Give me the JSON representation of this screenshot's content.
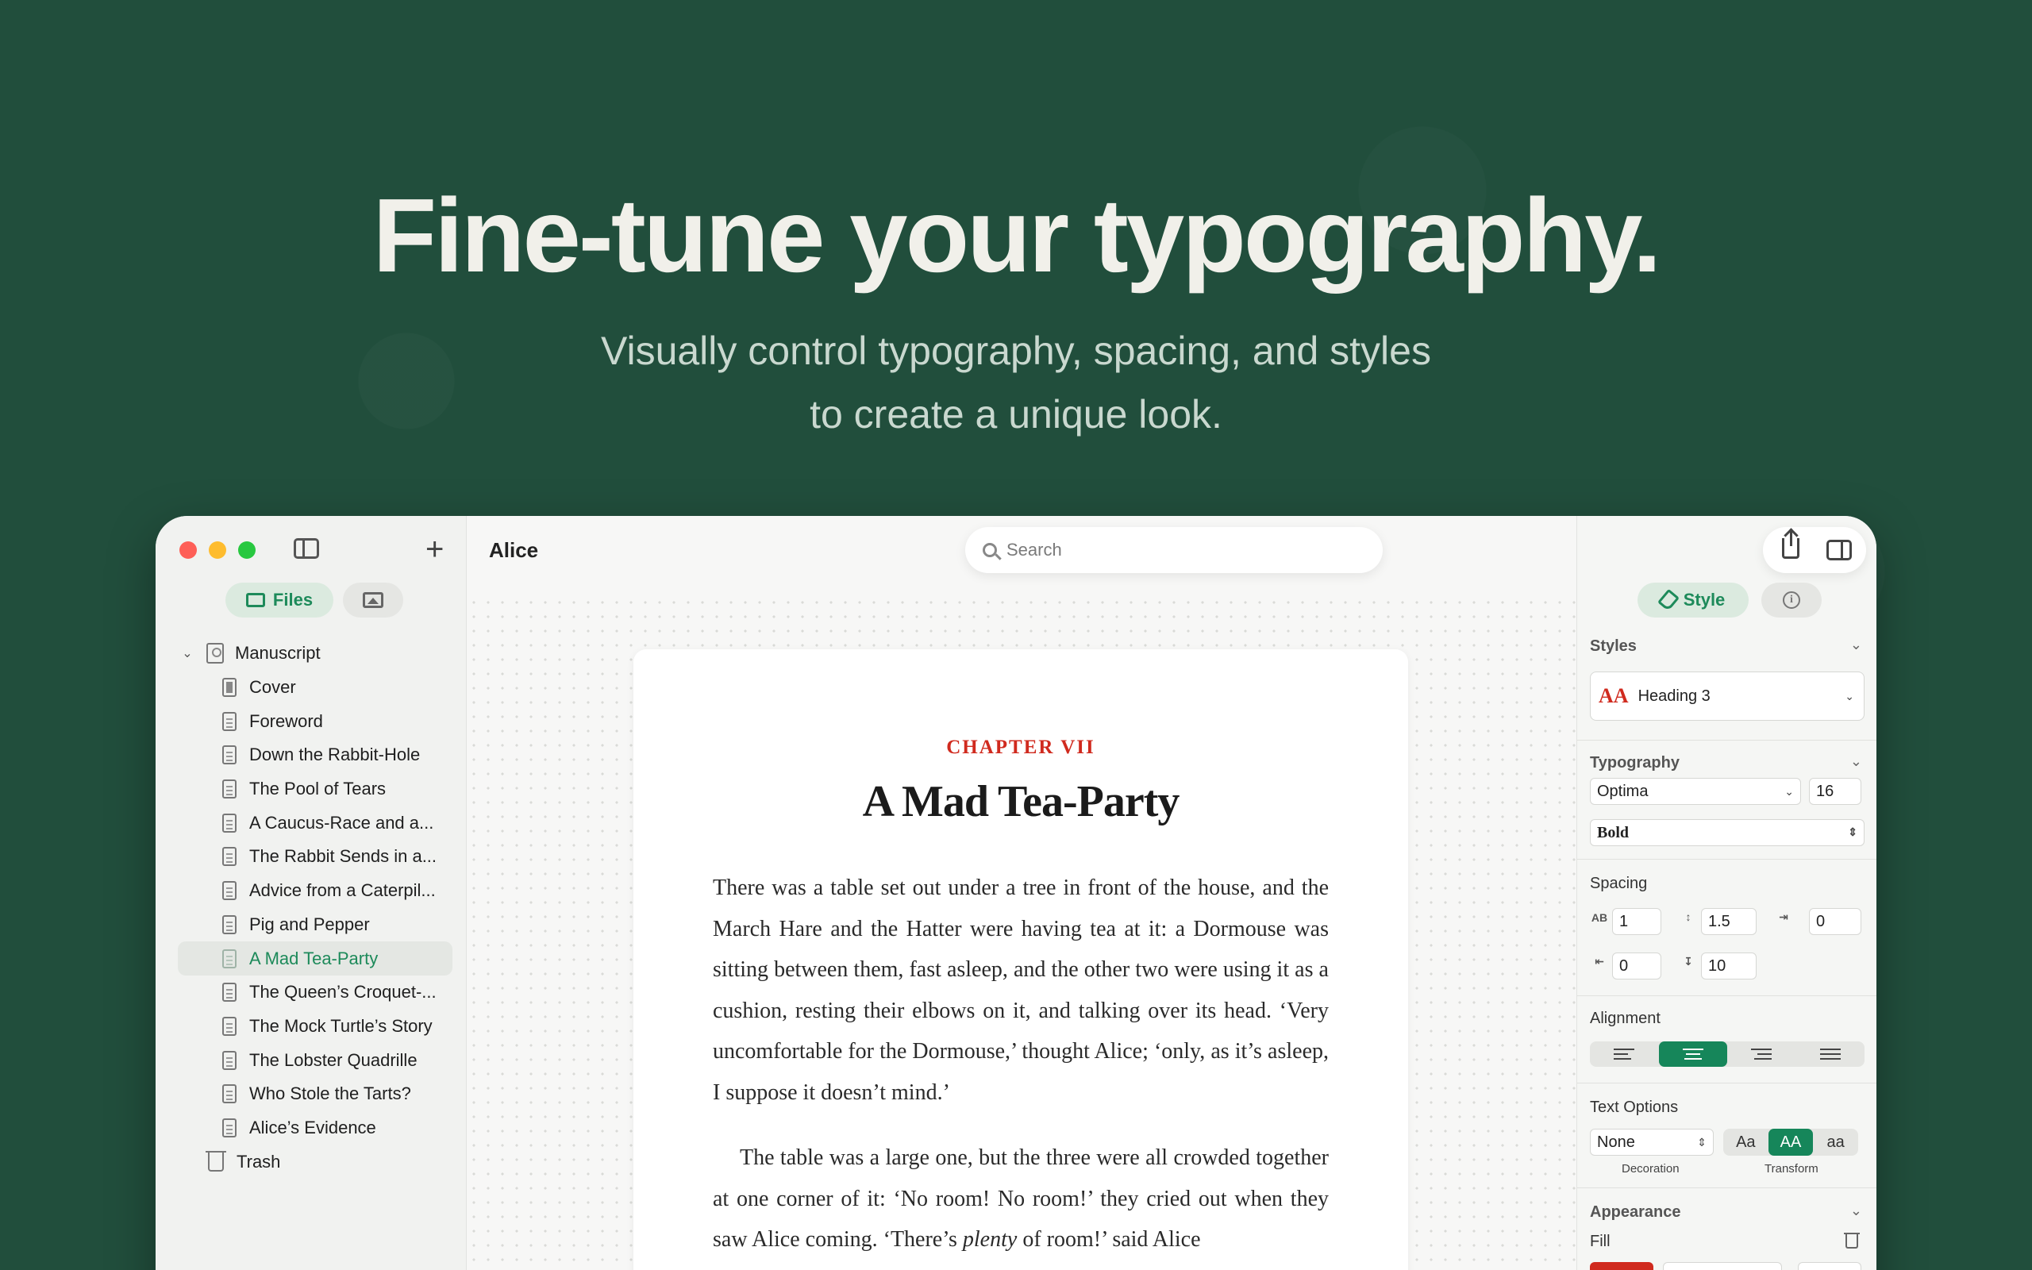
{
  "hero": {
    "title": "Fine-tune your typography.",
    "subtitle_line1": "Visually control typography, spacing, and styles",
    "subtitle_line2": "to create a unique look."
  },
  "sidebar": {
    "tabs": {
      "files": "Files"
    },
    "tree": [
      {
        "label": "Manuscript",
        "type": "root"
      },
      {
        "label": "Cover",
        "type": "cover"
      },
      {
        "label": "Foreword",
        "type": "doc"
      },
      {
        "label": "Down the Rabbit-Hole",
        "type": "doc"
      },
      {
        "label": "The Pool of Tears",
        "type": "doc"
      },
      {
        "label": "A Caucus-Race and a...",
        "type": "doc"
      },
      {
        "label": "The Rabbit Sends in a...",
        "type": "doc"
      },
      {
        "label": "Advice from a Caterpil...",
        "type": "doc"
      },
      {
        "label": "Pig and Pepper",
        "type": "doc"
      },
      {
        "label": "A Mad Tea-Party",
        "type": "doc",
        "active": true
      },
      {
        "label": "The Queen’s Croquet-...",
        "type": "doc"
      },
      {
        "label": "The Mock Turtle’s Story",
        "type": "doc"
      },
      {
        "label": "The Lobster Quadrille",
        "type": "doc"
      },
      {
        "label": "Who Stole the Tarts?",
        "type": "doc"
      },
      {
        "label": "Alice’s Evidence",
        "type": "doc"
      },
      {
        "label": "Trash",
        "type": "trash"
      }
    ]
  },
  "main": {
    "title": "Alice",
    "search_placeholder": "Search"
  },
  "document": {
    "chapter": "CHAPTER VII",
    "title": "A Mad Tea-Party",
    "para1": "There was a table set out under a tree in front of the house, and the March Hare and the Hatter were having tea at it: a Dormouse was sitting between them, fast asleep, and the other two were using it as a cushion, resting their elbows on it, and talking over its head. ‘Very uncomfortable for the Dormouse,’ thought Alice; ‘only, as it’s asleep, I suppose it doesn’t mind.’",
    "para2_start": "The table was a large one, but the three were all crowded together at one corner of it: ‘No room! No room!’ they cried out when they saw Alice coming. ‘There’s ",
    "para2_italic": "plenty",
    "para2_end": " of room!’ said Alice"
  },
  "inspector": {
    "style_tab": "Style",
    "styles_label": "Styles",
    "style_value": "Heading 3",
    "style_icon": "AA",
    "typography_label": "Typography",
    "font_family": "Optima",
    "font_size": "16",
    "font_weight": "Bold",
    "spacing_label": "Spacing",
    "letter_spacing": "1",
    "line_height": "1.5",
    "indent_first": "0",
    "space_before": "0",
    "space_after": "10",
    "alignment_label": "Alignment",
    "alignment_selected": "center",
    "text_options_label": "Text Options",
    "decoration_value": "None",
    "decoration_label": "Decoration",
    "transform_options": [
      "Aa",
      "AA",
      "aa"
    ],
    "transform_selected": "AA",
    "transform_label": "Transform",
    "appearance_label": "Appearance",
    "fill_label": "Fill",
    "accent_color": "#16865a",
    "fill_color": "#d02a1e"
  }
}
